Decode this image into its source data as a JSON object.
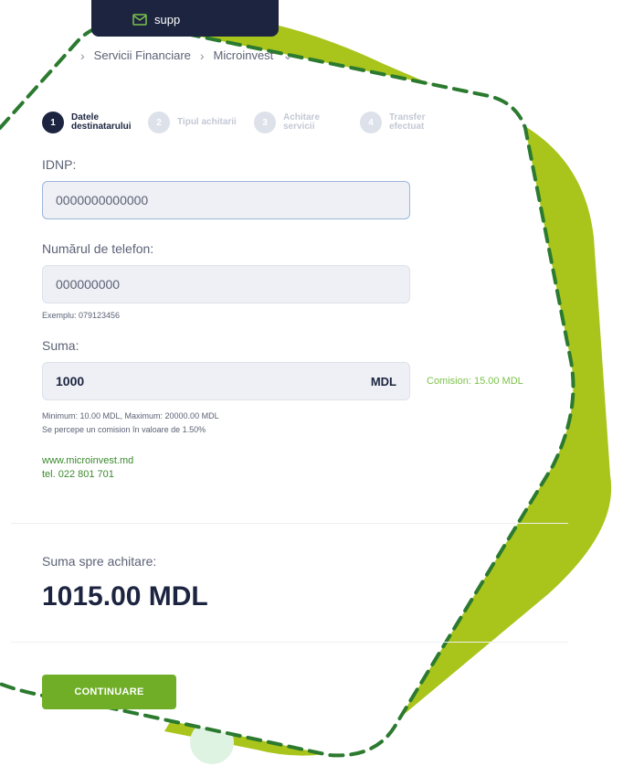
{
  "header": {
    "support_label": "supp",
    "support_icon": "mail-icon"
  },
  "breadcrumb": {
    "items": [
      "Servicii Financiare",
      "Microinvest"
    ]
  },
  "steps": [
    {
      "num": "1",
      "label": "Datele destinatarului",
      "active": true
    },
    {
      "num": "2",
      "label": "Tipul achitarii",
      "active": false
    },
    {
      "num": "3",
      "label": "Achitare servicii",
      "active": false
    },
    {
      "num": "4",
      "label": "Transfer efectuat",
      "active": false
    }
  ],
  "form": {
    "idnp_label": "IDNP:",
    "idnp_value": "0000000000000",
    "phone_label": "Numărul de telefon:",
    "phone_value": "000000000",
    "phone_hint": "Exemplu: 079123456",
    "amount_label": "Suma:",
    "amount_value": "1000",
    "amount_currency": "MDL",
    "commission": "Comision: 15.00 MDL",
    "limits": "Minimum: 10.00 MDL, Maximum: 20000.00 MDL",
    "commission_note": "Se percepe un comision în valoare de 1.50%",
    "website": "www.microinvest.md",
    "phone_contact": "tel. 022 801 701"
  },
  "summary": {
    "label": "Suma spre achitare:",
    "value": "1015.00 MDL"
  },
  "actions": {
    "continue_label": "CONTINUARE"
  },
  "colors": {
    "navy": "#1c2440",
    "green": "#6fae26",
    "lime": "#a9c41b",
    "dashed": "#2b7a2f"
  }
}
